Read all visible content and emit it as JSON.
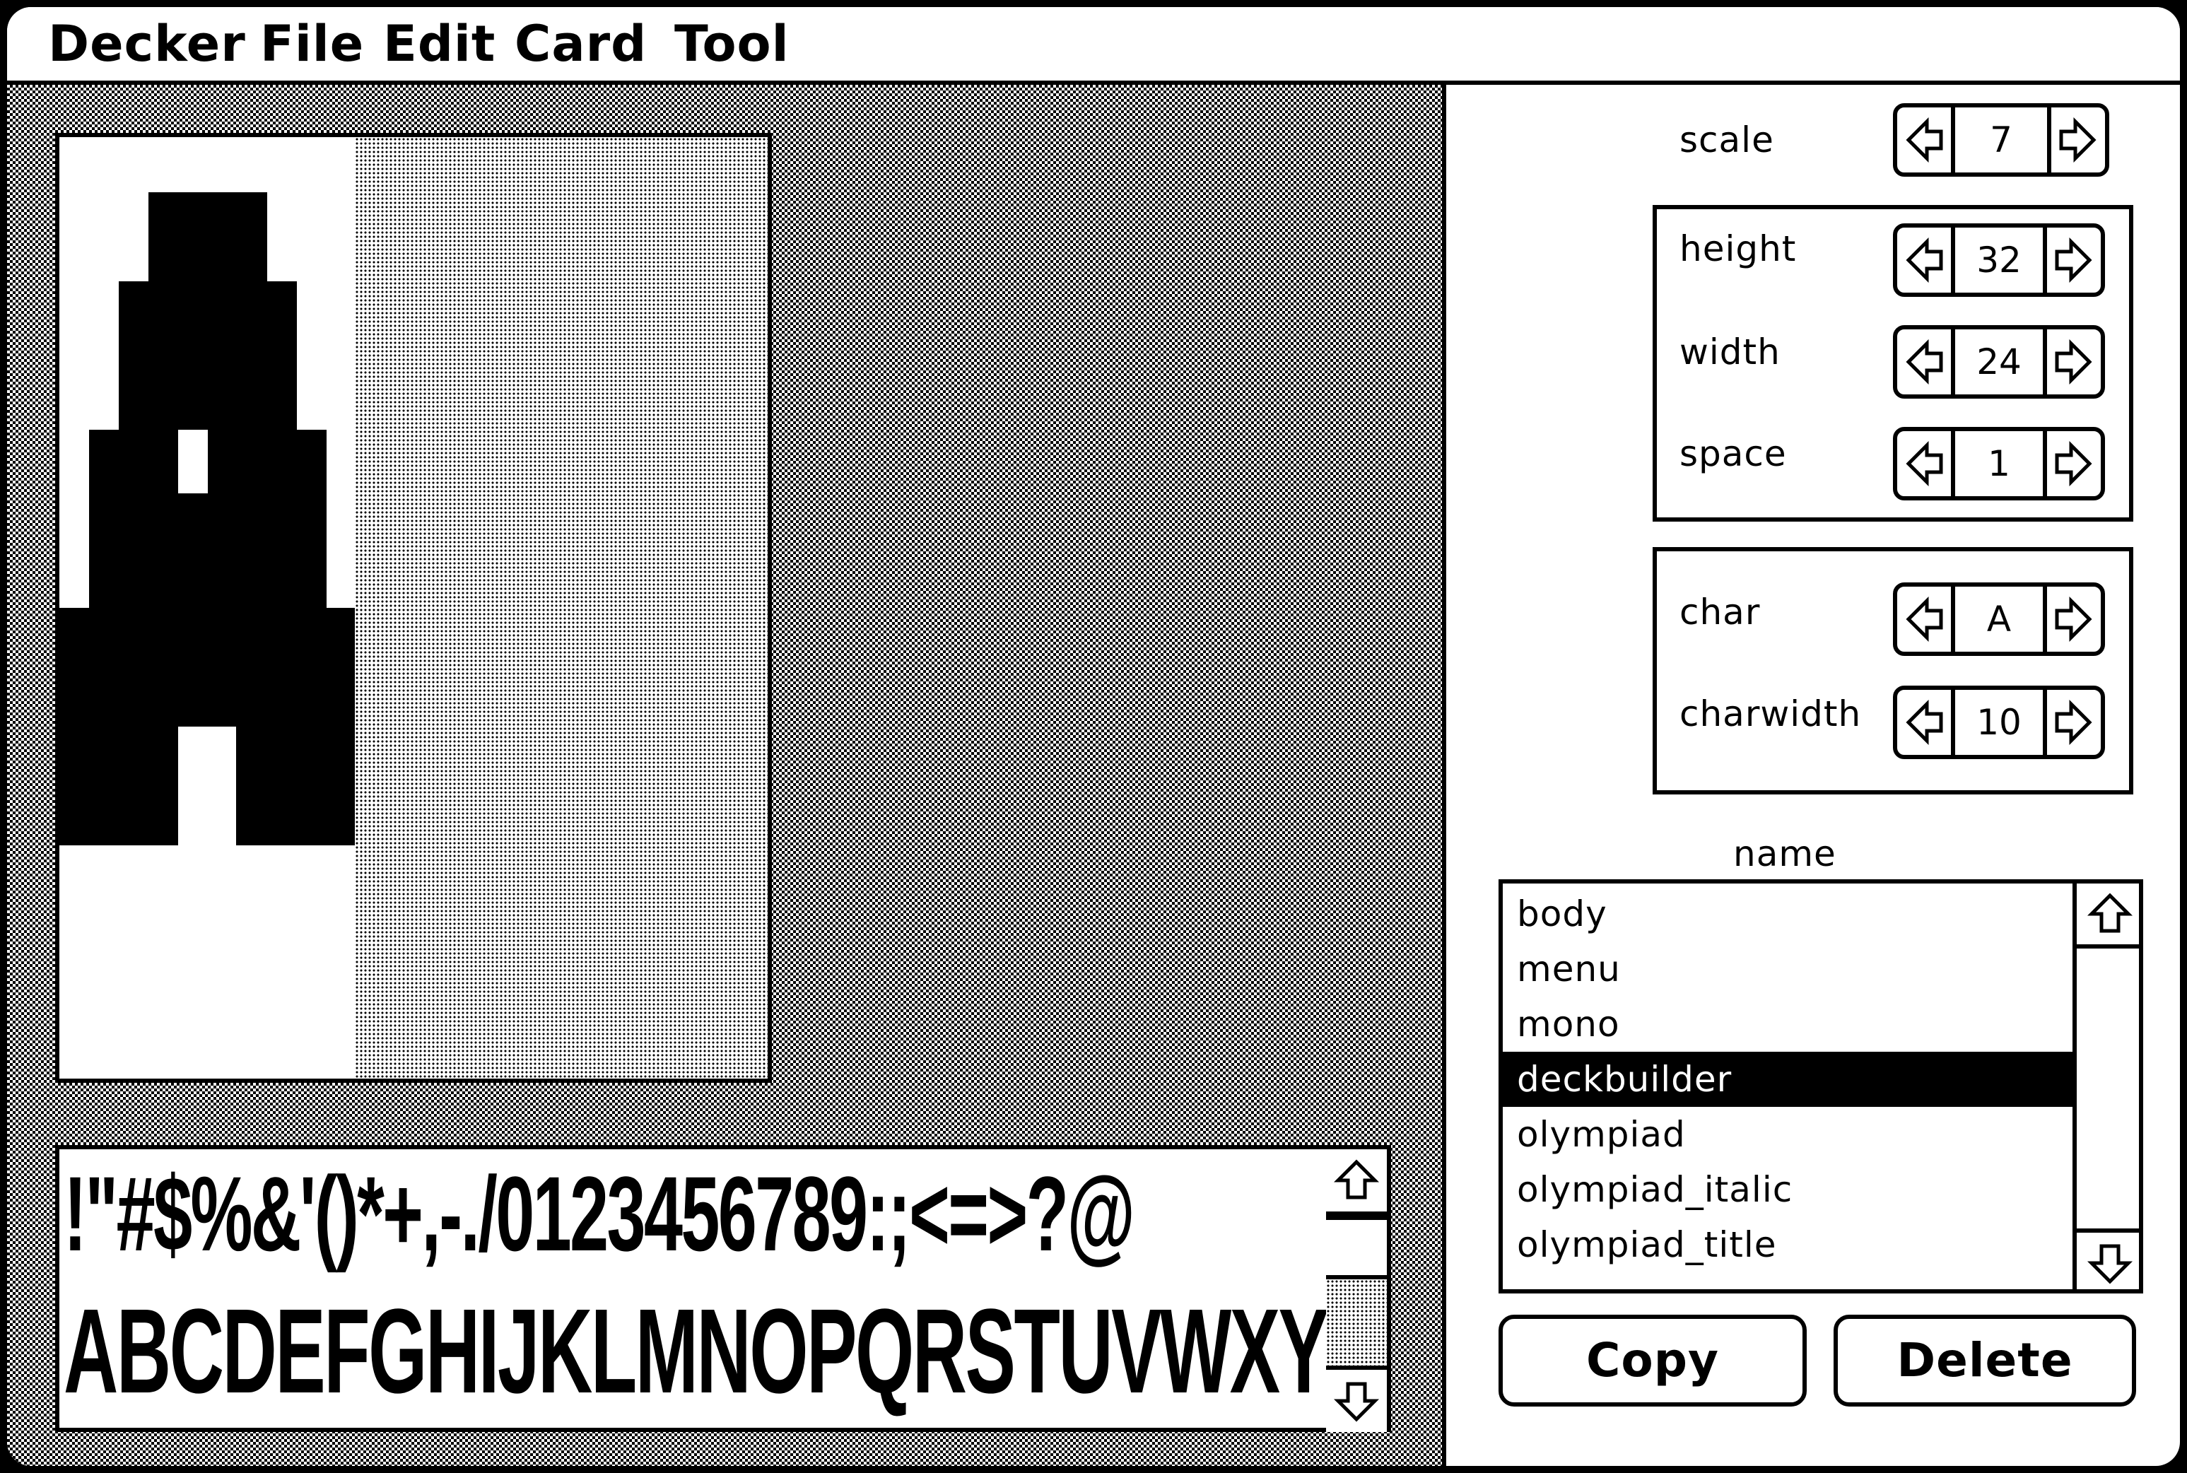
{
  "menubar": {
    "items": [
      "Decker",
      "File",
      "Edit",
      "Card",
      "Tool"
    ]
  },
  "preview": {
    "line1": "!\"#$%&'()*+,-./0123456789:;<=>?@",
    "line2": "ABCDEFGHIJKLMNOPQRSTUVWXYZ"
  },
  "panel": {
    "scale": {
      "label": "scale",
      "value": "7"
    },
    "height": {
      "label": "height",
      "value": "32"
    },
    "width": {
      "label": "width",
      "value": "24"
    },
    "space": {
      "label": "space",
      "value": "1"
    },
    "char": {
      "label": "char",
      "value": "A"
    },
    "charwidth": {
      "label": "charwidth",
      "value": "10"
    },
    "name_label": "name"
  },
  "fonts": {
    "items": [
      "body",
      "menu",
      "mono",
      "deckbuilder",
      "olympiad",
      "olympiad_italic",
      "olympiad_title"
    ],
    "selected": "deckbuilder"
  },
  "buttons": {
    "copy": "Copy",
    "delete": "Delete"
  },
  "icons": {
    "left_arrow": "left-arrow-icon",
    "right_arrow": "right-arrow-icon",
    "up_arrow": "up-arrow-icon",
    "down_arrow": "down-arrow-icon"
  }
}
